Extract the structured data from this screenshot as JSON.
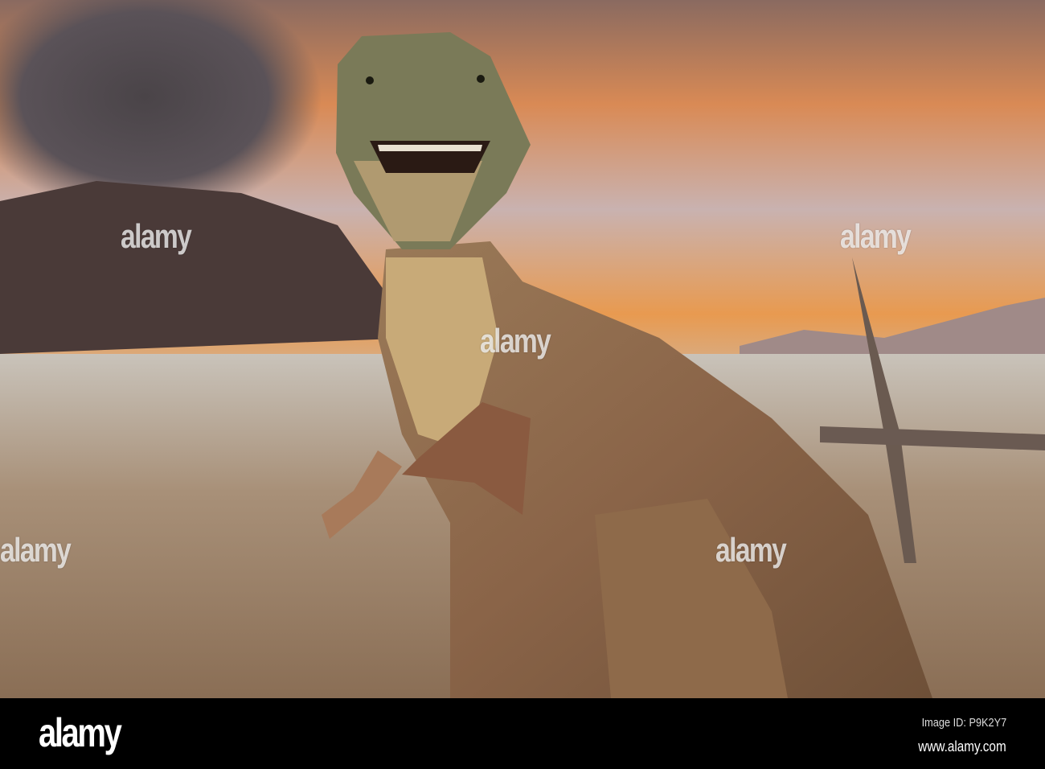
{
  "watermark": {
    "text": "alamy"
  },
  "footer": {
    "logo": "alamy",
    "image_id": "Image ID: P9K2Y7",
    "url": "www.alamy.com"
  }
}
